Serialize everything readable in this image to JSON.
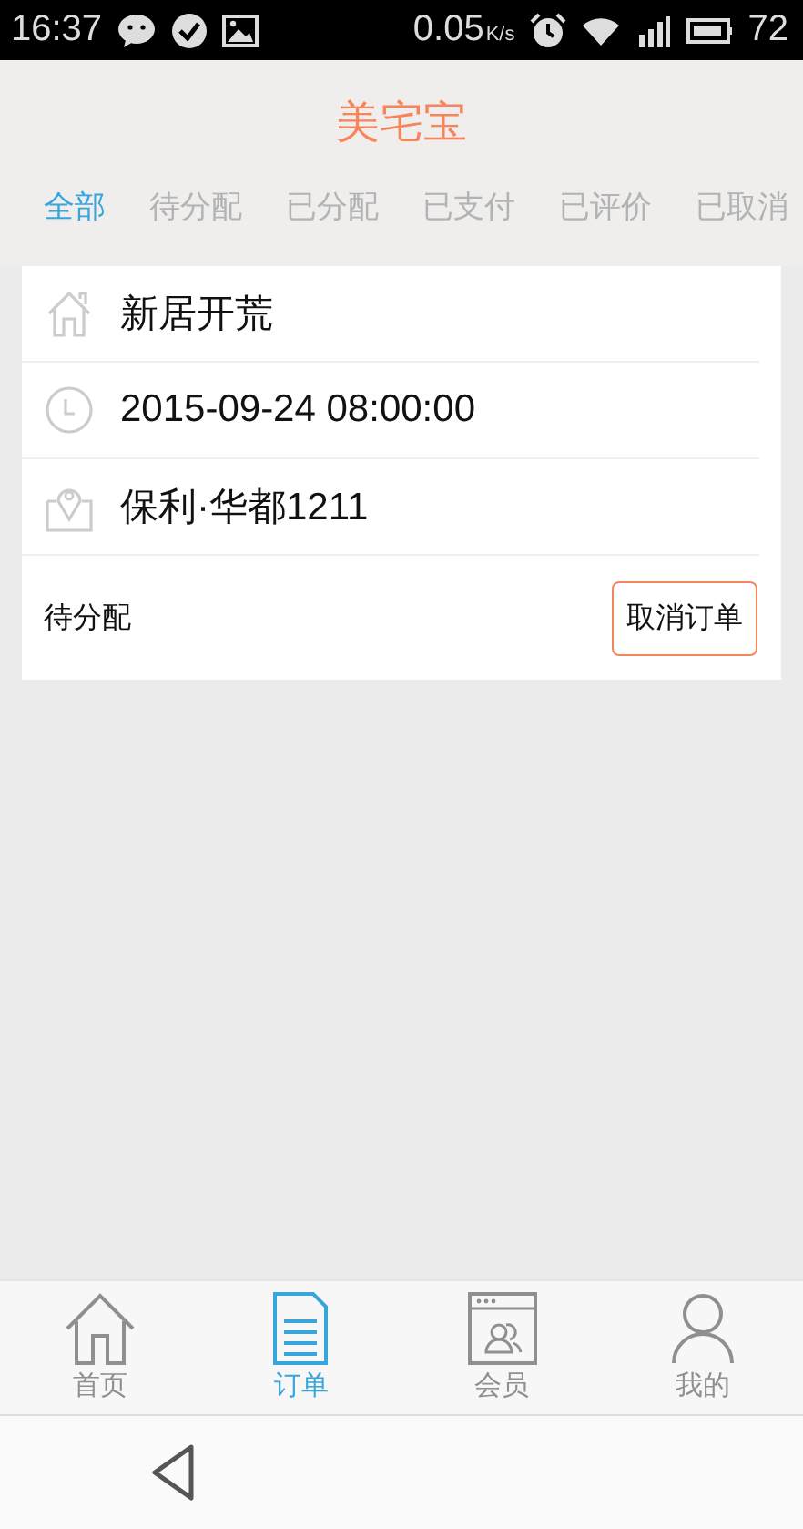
{
  "status_bar": {
    "time": "16:37",
    "speed": "0.05",
    "speed_unit": "K/s",
    "battery": "72"
  },
  "header": {
    "title": "美宅宝"
  },
  "tabs": [
    {
      "label": "全部",
      "selected": true
    },
    {
      "label": "待分配",
      "selected": false
    },
    {
      "label": "已分配",
      "selected": false
    },
    {
      "label": "已支付",
      "selected": false
    },
    {
      "label": "已评价",
      "selected": false
    },
    {
      "label": "已取消",
      "selected": false
    }
  ],
  "orders": [
    {
      "rows": [
        {
          "kind": "service",
          "text": "新居开荒"
        },
        {
          "kind": "time",
          "text": "2015-09-24 08:00:00"
        },
        {
          "kind": "address",
          "text": "保利·华都1211"
        }
      ],
      "status": "待分配",
      "action": "取消订单"
    }
  ],
  "bottom_nav": [
    {
      "kind": "home",
      "label": "首页",
      "selected": false
    },
    {
      "kind": "orders",
      "label": "订单",
      "selected": true
    },
    {
      "kind": "members",
      "label": "会员",
      "selected": false
    },
    {
      "kind": "me",
      "label": "我的",
      "selected": false
    }
  ]
}
